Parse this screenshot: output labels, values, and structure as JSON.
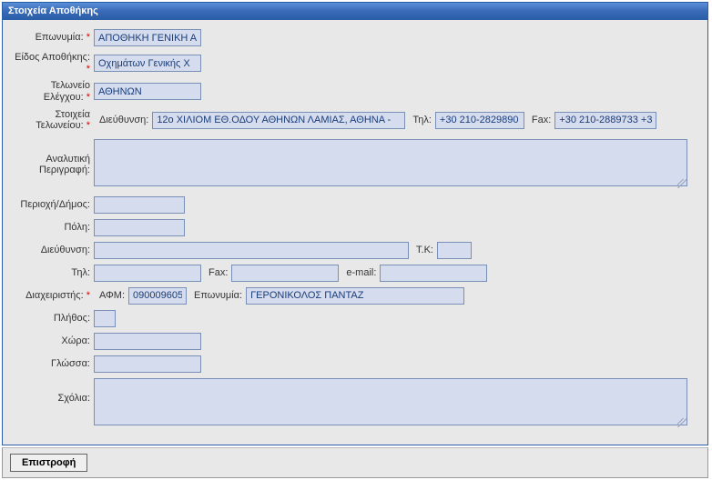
{
  "panel": {
    "title": "Στοιχεία Αποθήκης"
  },
  "labels": {
    "name": "Επωνυμία:",
    "type": "Είδος Αποθήκης:",
    "customs_office": "Τελωνείο Ελέγχου:",
    "customs_details": "Στοιχεία Τελωνείου:",
    "address": "Διεύθυνση:",
    "tel": "Τηλ:",
    "fax": "Fax:",
    "detailed_desc": "Αναλυτική Περιγραφή:",
    "region": "Περιοχή/Δήμος:",
    "city": "Πόλη:",
    "address2": "Διεύθυνση:",
    "postcode": "Τ.Κ:",
    "tel2": "Τηλ:",
    "fax2": "Fax:",
    "email": "e-mail:",
    "manager": "Διαχειριστής:",
    "afm": "ΑΦΜ:",
    "mgr_name": "Επωνυμία:",
    "count": "Πλήθος:",
    "country": "Χώρα:",
    "language": "Γλώσσα:",
    "comments": "Σχόλια:"
  },
  "values": {
    "name": "ΑΠΟΘΗΚΗ ΓΕΝΙΚΗ Α",
    "type": "Οχημάτων Γενικής Χ",
    "customs_office": "ΑΘΗΝΩΝ",
    "customs_address": "12ο ΧΙΛΙΟΜ ΕΘ.ΟΔΟΥ ΑΘΗΝΩΝ ΛΑΜΙΑΣ, ΑΘΗΝΑ -",
    "customs_tel": "+30 210-2829890",
    "customs_fax": "+30 210-2889733 +3",
    "detailed_desc": "",
    "region": "",
    "city": "",
    "address": "",
    "postcode": "",
    "tel": "",
    "fax": "",
    "email": "",
    "afm": "090009605",
    "mgr_name": "ΓΕΡΟΝΙΚΟΛΟΣ ΠΑΝΤΑΖ",
    "count": "",
    "country": "",
    "language": "",
    "comments": ""
  },
  "footer": {
    "back": "Επιστροφή"
  }
}
